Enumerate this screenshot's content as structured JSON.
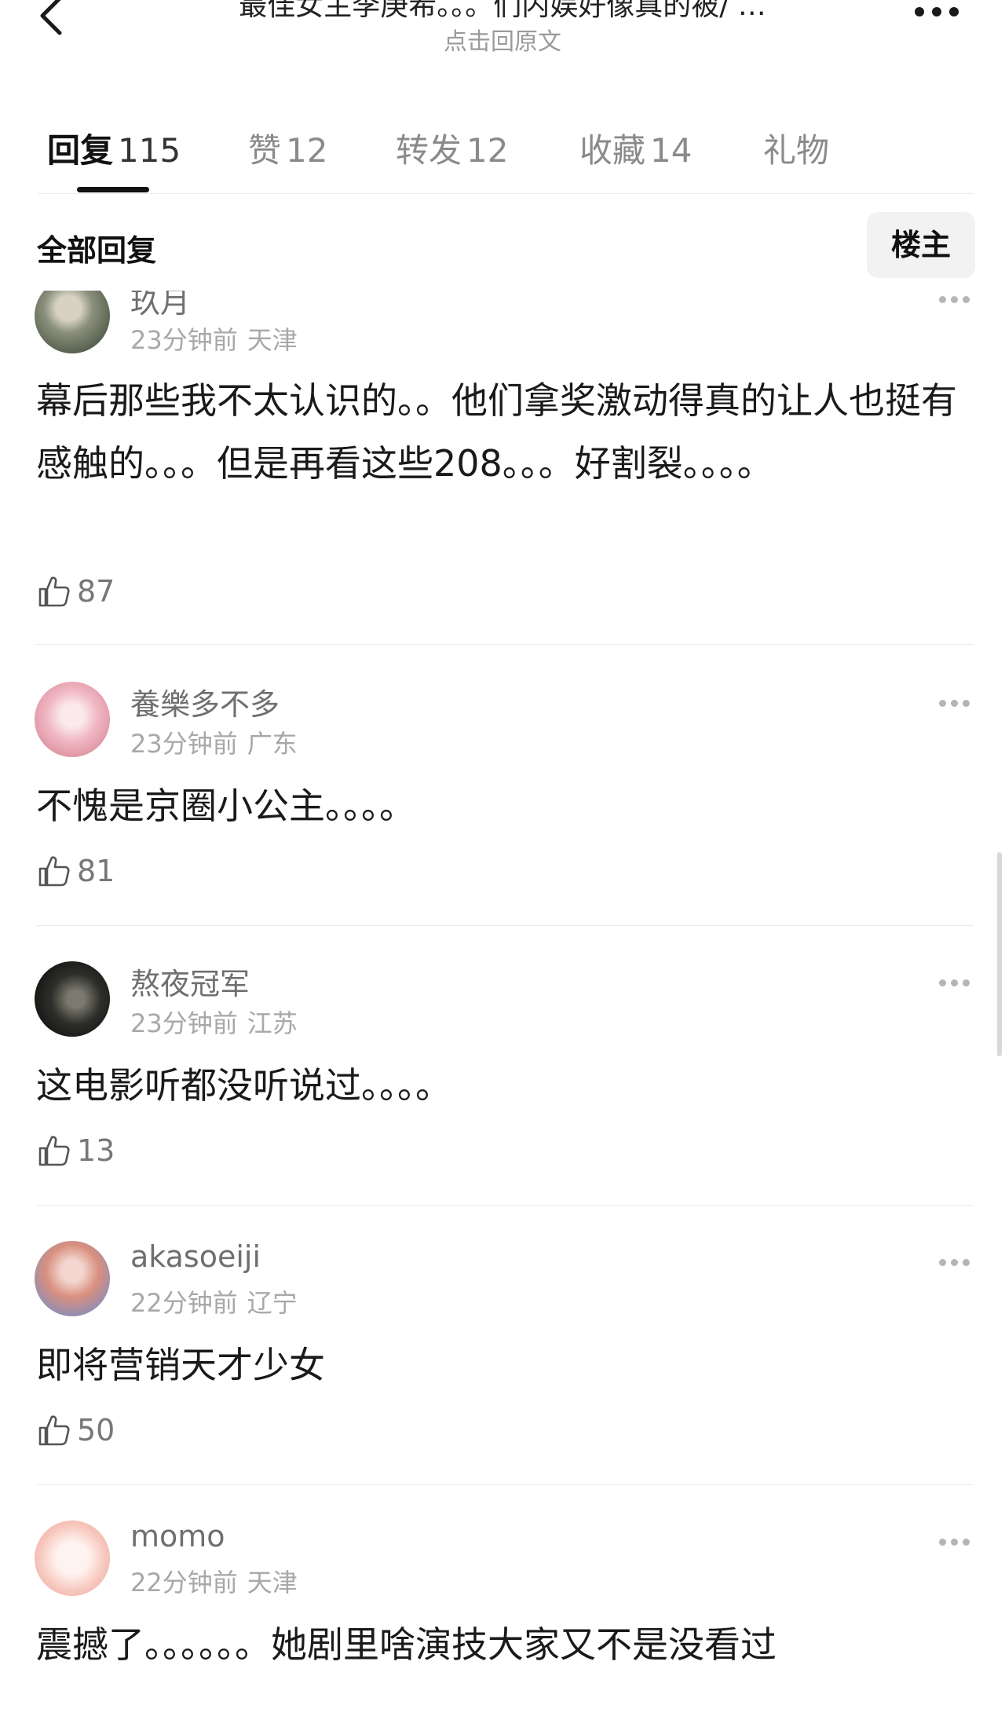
{
  "header": {
    "title": "最佳女主李庚希。。。们内娱好像真的被/ …",
    "subtitle": "点击回原文"
  },
  "tabs": [
    {
      "label": "回复",
      "count": "115"
    },
    {
      "label": "赞",
      "count": "12"
    },
    {
      "label": "转发",
      "count": "12"
    },
    {
      "label": "收藏",
      "count": "14"
    },
    {
      "label": "礼物",
      "count": ""
    }
  ],
  "section": {
    "title": "全部回复",
    "op_filter": "楼主"
  },
  "comments": [
    {
      "username": "玖月",
      "time": "23分钟前",
      "location": "天津",
      "text": "幕后那些我不太认识的。。他们拿奖激动得真的让人也挺有感触的。。。但是再看这些208。。。好割裂。。。。",
      "likes": "87"
    },
    {
      "username": "養樂多不多",
      "time": "23分钟前",
      "location": "广东",
      "text": "不愧是京圈小公主。。。。",
      "likes": "81"
    },
    {
      "username": "熬夜冠军",
      "time": "23分钟前",
      "location": "江苏",
      "text": "这电影听都没听说过。。。。",
      "likes": "13"
    },
    {
      "username": "akasoeiji",
      "time": "22分钟前",
      "location": "辽宁",
      "text": "即将营销天才少女",
      "likes": "50"
    },
    {
      "username": "momo",
      "time": "22分钟前",
      "location": "天津",
      "text": "震撼了。。。。。。她剧里啥演技大家又不是没看过",
      "likes": ""
    }
  ],
  "colors": {
    "accent": "#111111",
    "muted": "#8a8a8a",
    "divider": "#ebebeb"
  },
  "icons": {
    "back": "chevron-left-icon",
    "more": "more-dots-icon",
    "like": "thumbs-up-icon"
  }
}
